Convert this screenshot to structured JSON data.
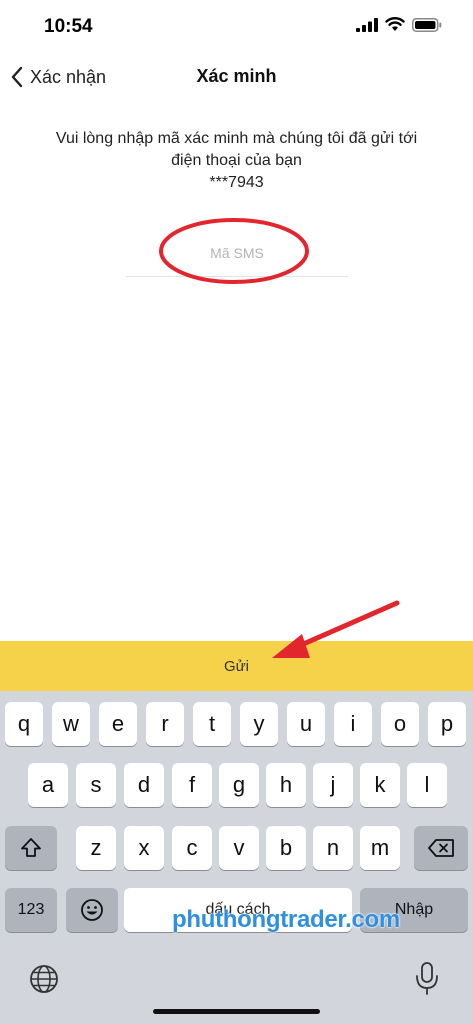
{
  "status_bar": {
    "time": "10:54",
    "signal_icon": "cellular-signal-icon",
    "wifi_icon": "wifi-icon",
    "battery_icon": "battery-icon"
  },
  "nav": {
    "back_label": "Xác nhận",
    "title": "Xác minh",
    "back_icon": "chevron-left-icon"
  },
  "instruction": {
    "line1": "Vui lòng nhập mã xác minh mà chúng tôi đã gửi tới",
    "line2": "điện thoại của bạn",
    "phone": "***7943"
  },
  "sms_input": {
    "placeholder": "Mã SMS",
    "value": ""
  },
  "send_button": {
    "label": "Gửi"
  },
  "keyboard": {
    "row1": [
      "q",
      "w",
      "e",
      "r",
      "t",
      "y",
      "u",
      "i",
      "o",
      "p"
    ],
    "row2": [
      "a",
      "s",
      "d",
      "f",
      "g",
      "h",
      "j",
      "k",
      "l"
    ],
    "row3": [
      "z",
      "x",
      "c",
      "v",
      "b",
      "n",
      "m"
    ],
    "shift_icon": "shift-icon",
    "delete_icon": "backspace-icon",
    "numbers_label": "123",
    "emoji_icon": "emoji-icon",
    "space_label": "dấu cách",
    "return_label": "Nhập",
    "globe_icon": "globe-icon",
    "mic_icon": "microphone-icon"
  },
  "watermark": "phuthongtrader.com",
  "colors": {
    "send_bar": "#f6d24b",
    "annotation": "#e3262d",
    "keyboard_bg": "#d2d5db",
    "watermark": "#2f8fe0"
  }
}
